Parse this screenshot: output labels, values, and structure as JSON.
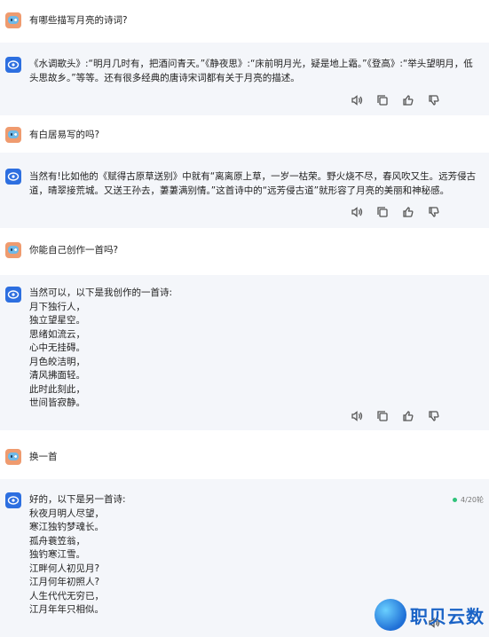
{
  "conversation": [
    {
      "role": "user",
      "text": "有哪些描写月亮的诗词?"
    },
    {
      "role": "bot",
      "text": "《水调歌头》:“明月几时有，把酒问青天。”《静夜思》:“床前明月光，疑是地上霜。”《登高》:“举头望明月，低头思故乡。”等等。还有很多经典的唐诗宋词都有关于月亮的描述。"
    },
    {
      "role": "user",
      "text": "有白居易写的吗?"
    },
    {
      "role": "bot",
      "text": "当然有!比如他的《赋得古原草送别》中就有“离离原上草，一岁一枯荣。野火烧不尽，春风吹又生。远芳侵古道，晴翠接荒城。又送王孙去，萋萋满别情。”这首诗中的“远芳侵古道”就形容了月亮的美丽和神秘感。"
    },
    {
      "role": "user",
      "text": "你能自己创作一首吗?"
    },
    {
      "role": "bot",
      "text": "当然可以，以下是我创作的一首诗:\n月下独行人，\n独立望星空。\n思绪如流云，\n心中无挂碍。\n月色皎洁明，\n清风拂面轻。\n此时此刻此，\n世间皆寂静。"
    },
    {
      "role": "user",
      "text": "换一首"
    },
    {
      "role": "bot",
      "text": "好的，以下是另一首诗:\n秋夜月明人尽望，\n寒江独钓梦魂长。\n孤舟蓑笠翁，\n独钓寒江雪。\n江畔何人初见月?\n江月何年初照人?\n人生代代无穷已，\n江月年年只相似。"
    }
  ],
  "status": {
    "text": "4/20轮",
    "color": "#2fc27a"
  },
  "logo": {
    "text": "职贝云数"
  },
  "colors": {
    "bot_bg": "#f4f6fa",
    "accent": "#2d6fe0"
  }
}
